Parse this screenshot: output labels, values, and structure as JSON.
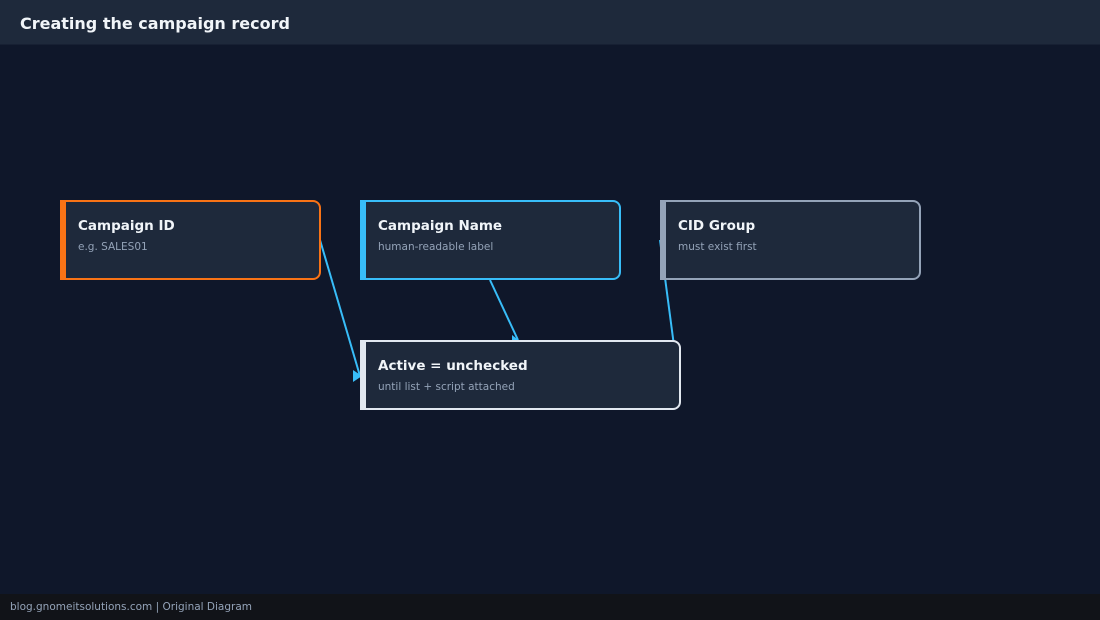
{
  "header": {
    "title": "Creating the campaign record"
  },
  "nodes": [
    {
      "id": "campaign-id",
      "title": "Campaign ID",
      "subtitle": "e.g. SALES01",
      "color": "#f97316"
    },
    {
      "id": "campaign-name",
      "title": "Campaign Name",
      "subtitle": "human-readable label",
      "color": "#38bdf8"
    },
    {
      "id": "cid-group",
      "title": "CID Group",
      "subtitle": "must exist first",
      "color": "#94a3b8"
    },
    {
      "id": "active",
      "title": "Active = unchecked",
      "subtitle": "until list + script attached",
      "color": "#e2e8f0"
    }
  ],
  "edges": [
    {
      "from": "campaign-id",
      "to": "active"
    },
    {
      "from": "campaign-name",
      "to": "active"
    },
    {
      "from": "cid-group",
      "to": "active"
    }
  ],
  "colors": {
    "edge": "#38bdf8",
    "background": "#0f172a",
    "node_fill": "#1e293b"
  },
  "footer": {
    "text": "blog.gnomeitsolutions.com | Original Diagram"
  }
}
